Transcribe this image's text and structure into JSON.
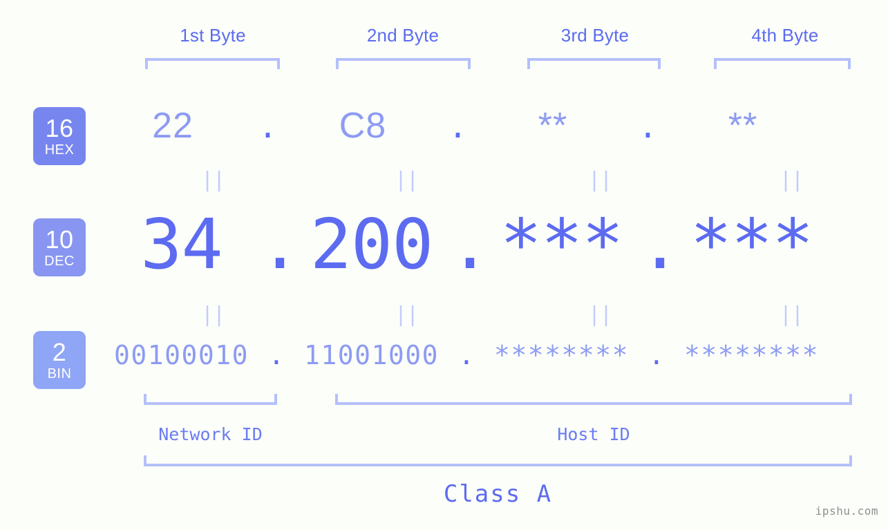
{
  "page": {
    "background_color": "#fcfefa",
    "accent_color": "#5c6bf0",
    "accent_light_color": "#8d9bf2",
    "bracket_color": "#b4c0fb",
    "watermark": "ipshu.com"
  },
  "byte_headers": [
    {
      "label": "1st Byte"
    },
    {
      "label": "2nd Byte"
    },
    {
      "label": "3rd Byte"
    },
    {
      "label": "4th Byte"
    }
  ],
  "bases": [
    {
      "number": "16",
      "unit": "HEX",
      "color": "#7786ee"
    },
    {
      "number": "10",
      "unit": "DEC",
      "color": "#8896f1"
    },
    {
      "number": "2",
      "unit": "BIN",
      "color": "#8fa5f5"
    }
  ],
  "separator": {
    "dot": ".",
    "equals": "||"
  },
  "rows": {
    "hex": {
      "base_label": "16",
      "base_unit": "HEX",
      "values": [
        "22",
        "C8",
        "**",
        "**"
      ]
    },
    "dec": {
      "base_label": "10",
      "base_unit": "DEC",
      "values": [
        "34",
        "200",
        "***",
        "***"
      ]
    },
    "bin": {
      "base_label": "2",
      "base_unit": "BIN",
      "values": [
        "00100010",
        "11001000",
        "********",
        "********"
      ]
    }
  },
  "segments": {
    "network_id": "Network ID",
    "host_id": "Host ID",
    "class": "Class A"
  }
}
